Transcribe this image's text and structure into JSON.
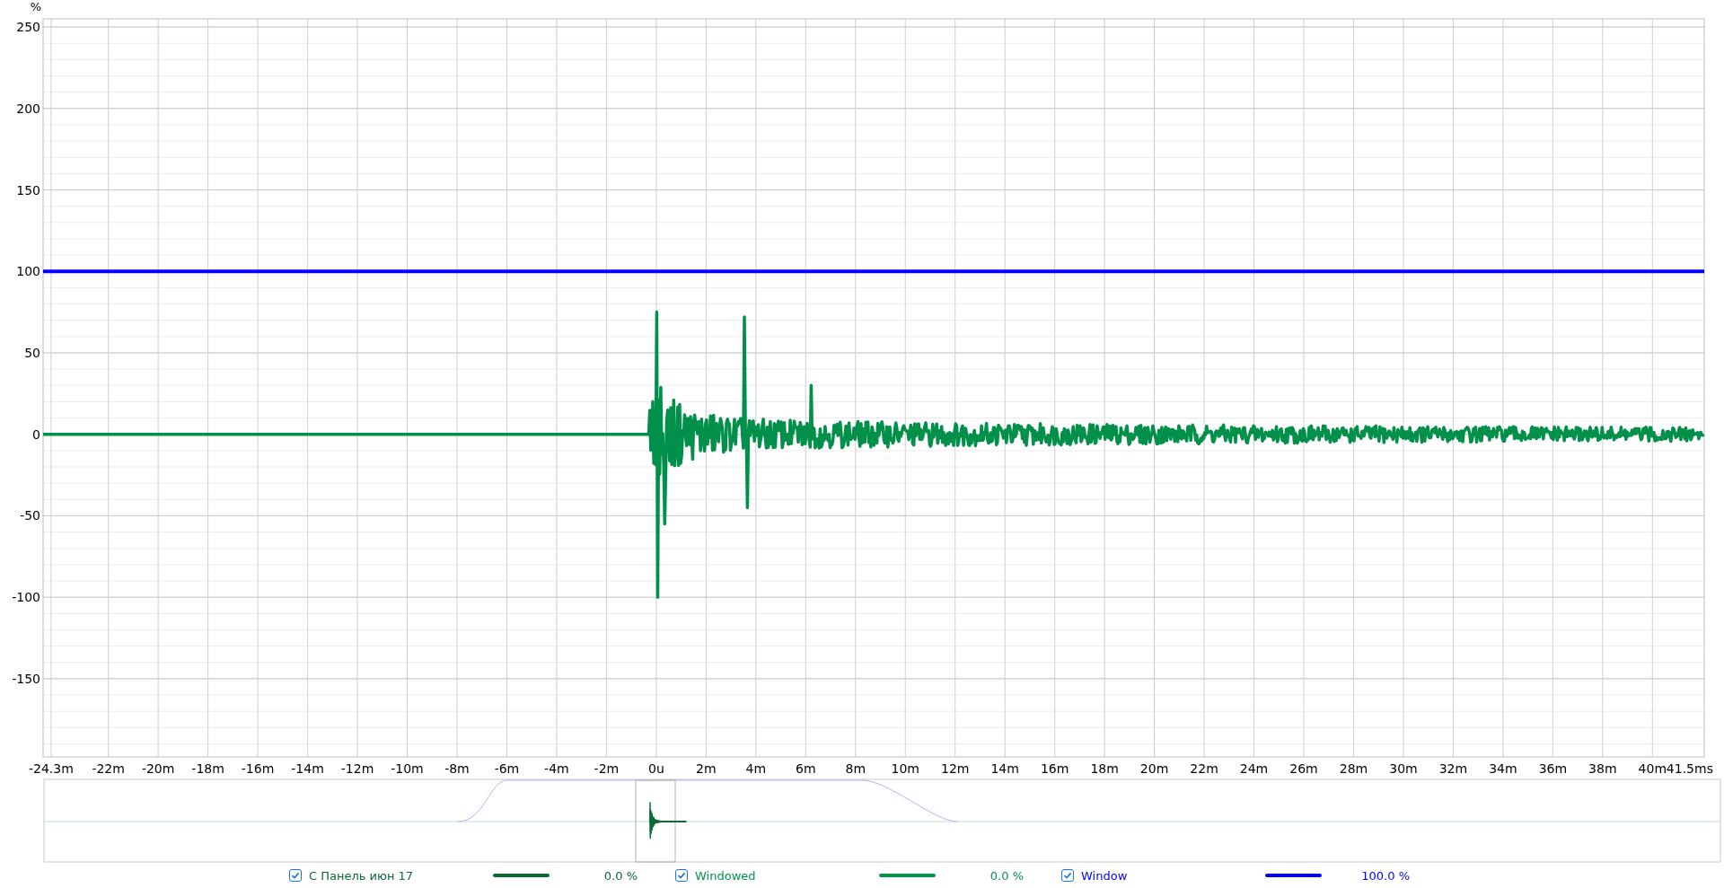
{
  "chart": {
    "unit_label": "%",
    "chart_data": {
      "type": "line",
      "grid": true,
      "xlim": [
        -24.62,
        42.08
      ],
      "ylim": [
        -198,
        255
      ],
      "xticks": [
        {
          "value": -24.3,
          "label": "-24.3m"
        },
        {
          "value": -22,
          "label": "-22m"
        },
        {
          "value": -20,
          "label": "-20m"
        },
        {
          "value": -18,
          "label": "-18m"
        },
        {
          "value": -16,
          "label": "-16m"
        },
        {
          "value": -14,
          "label": "-14m"
        },
        {
          "value": -12,
          "label": "-12m"
        },
        {
          "value": -10,
          "label": "-10m"
        },
        {
          "value": -8,
          "label": "-8m"
        },
        {
          "value": -6,
          "label": "-6m"
        },
        {
          "value": -4,
          "label": "-4m"
        },
        {
          "value": -2,
          "label": "-2m"
        },
        {
          "value": 0,
          "label": "0u"
        },
        {
          "value": 2,
          "label": "2m"
        },
        {
          "value": 4,
          "label": "4m"
        },
        {
          "value": 6,
          "label": "6m"
        },
        {
          "value": 8,
          "label": "8m"
        },
        {
          "value": 10,
          "label": "10m"
        },
        {
          "value": 12,
          "label": "12m"
        },
        {
          "value": 14,
          "label": "14m"
        },
        {
          "value": 16,
          "label": "16m"
        },
        {
          "value": 18,
          "label": "18m"
        },
        {
          "value": 20,
          "label": "20m"
        },
        {
          "value": 22,
          "label": "22m"
        },
        {
          "value": 24,
          "label": "24m"
        },
        {
          "value": 26,
          "label": "26m"
        },
        {
          "value": 28,
          "label": "28m"
        },
        {
          "value": 30,
          "label": "30m"
        },
        {
          "value": 32,
          "label": "32m"
        },
        {
          "value": 34,
          "label": "34m"
        },
        {
          "value": 36,
          "label": "36m"
        },
        {
          "value": 38,
          "label": "38m"
        },
        {
          "value": 40,
          "label": "40m"
        },
        {
          "value": 41.5,
          "label": "41.5ms"
        }
      ],
      "yticks": [
        -150,
        -100,
        -50,
        0,
        50,
        100,
        150,
        200,
        250
      ],
      "x": [
        -24.62,
        42.08
      ],
      "series": [
        {
          "color": "#0000ff",
          "values": [
            100,
            100
          ]
        }
      ]
    }
  },
  "legend": [
    {
      "checked": true,
      "label": "С Панель июн 17",
      "color": "#0b6b35",
      "value": "0.0 %"
    },
    {
      "checked": true,
      "label": "Windowed",
      "color": "#00964a",
      "value": "0.0 %"
    },
    {
      "checked": true,
      "label": "Window",
      "color": "#0000ff",
      "value": "100.0 %"
    }
  ]
}
